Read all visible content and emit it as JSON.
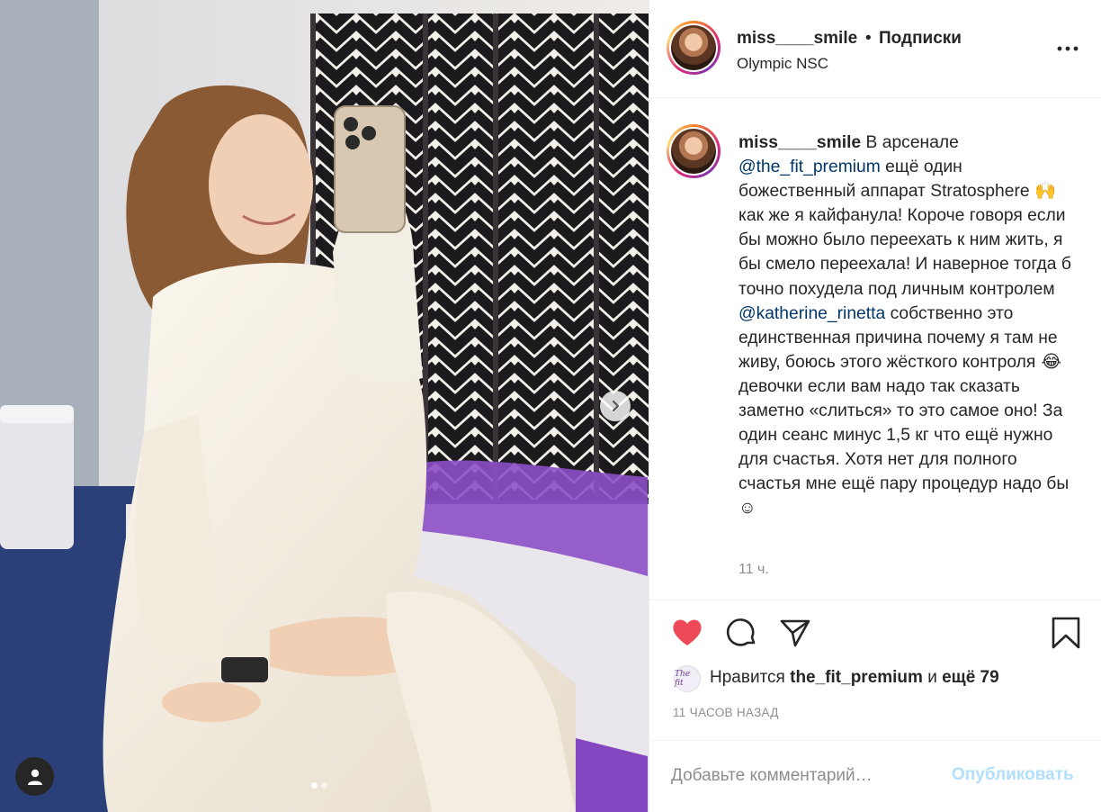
{
  "post": {
    "username": "miss____smile",
    "separator": "•",
    "follow_label": "Подписки",
    "location": "Olympic NSC"
  },
  "caption": {
    "username": "miss____smile",
    "part1": " В арсенале ",
    "mention1": "@the_fit_premium",
    "part2": " ещё один божественный аппарат Stratosphere ",
    "emoji1": "🙌",
    "part3": " как же я кайфанула! Короче говоря если бы можно было переехать к ним жить, я бы смело переехала! И наверное тогда б точно похудела под личным контролем ",
    "mention2": "@katherine_rinetta",
    "part4": " собственно это единственная причина почему я там не живу, боюсь этого жёсткого контроля ",
    "emoji2": "😂",
    "part5": " девочки если вам надо так сказать заметно «слиться» то это самое оно! За один сеанс минус 1,5 кг что ещё нужно для счастья. Хотя нет для полного счастья мне ещё пару процедур надо бы ☺",
    "time": "11 ч."
  },
  "likes": {
    "prefix": "Нравится ",
    "user": "the_fit_premium",
    "middle": " и ",
    "more": "ещё 79",
    "avatar_text": "The fit"
  },
  "post_age": "11 ЧАСОВ НАЗАД",
  "comment": {
    "placeholder": "Добавьте комментарий…",
    "publish_label": "Опубликовать"
  },
  "carousel": {
    "current": 1,
    "total": 2
  },
  "colors": {
    "like": "#ed4956",
    "mention": "#00376b",
    "publish_disabled": "#b2dffc",
    "muted": "#8e8e8e"
  },
  "icons": {
    "like": "heart-icon",
    "comment": "comment-icon",
    "share": "share-icon",
    "save": "bookmark-icon",
    "more": "more-icon",
    "next": "chevron-right-icon",
    "tags": "user-tag-icon"
  }
}
